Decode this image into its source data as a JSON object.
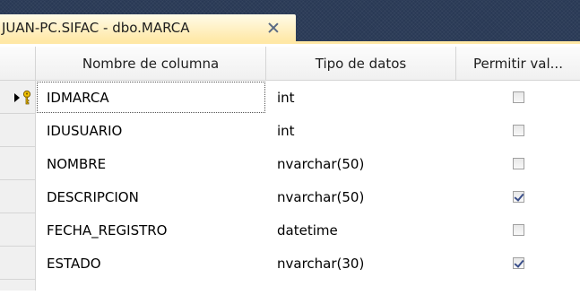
{
  "tab": {
    "title": "JUAN-PC.SIFAC - dbo.MARCA",
    "close_icon": "close-icon"
  },
  "colors": {
    "tab_strip": "#293955",
    "active_tab": "#ffe8a6",
    "grid_border": "#d5d5d5",
    "check_mark": "#3b4f8a"
  },
  "grid": {
    "columns": {
      "name": "Nombre de columna",
      "type": "Tipo de datos",
      "allow_nulls": "Permitir val..."
    },
    "rows": [
      {
        "name": "IDMARCA",
        "type": "int",
        "allow_nulls": false,
        "primary_key": true,
        "selector_icon": "primary-key-arrow-icon"
      },
      {
        "name": "IDUSUARIO",
        "type": "int",
        "allow_nulls": false,
        "primary_key": false
      },
      {
        "name": "NOMBRE",
        "type": "nvarchar(50)",
        "allow_nulls": false,
        "primary_key": false
      },
      {
        "name": "DESCRIPCION",
        "type": "nvarchar(50)",
        "allow_nulls": true,
        "primary_key": false
      },
      {
        "name": "FECHA_REGISTRO",
        "type": "datetime",
        "allow_nulls": false,
        "primary_key": false
      },
      {
        "name": "ESTADO",
        "type": "nvarchar(30)",
        "allow_nulls": true,
        "primary_key": false
      }
    ]
  }
}
